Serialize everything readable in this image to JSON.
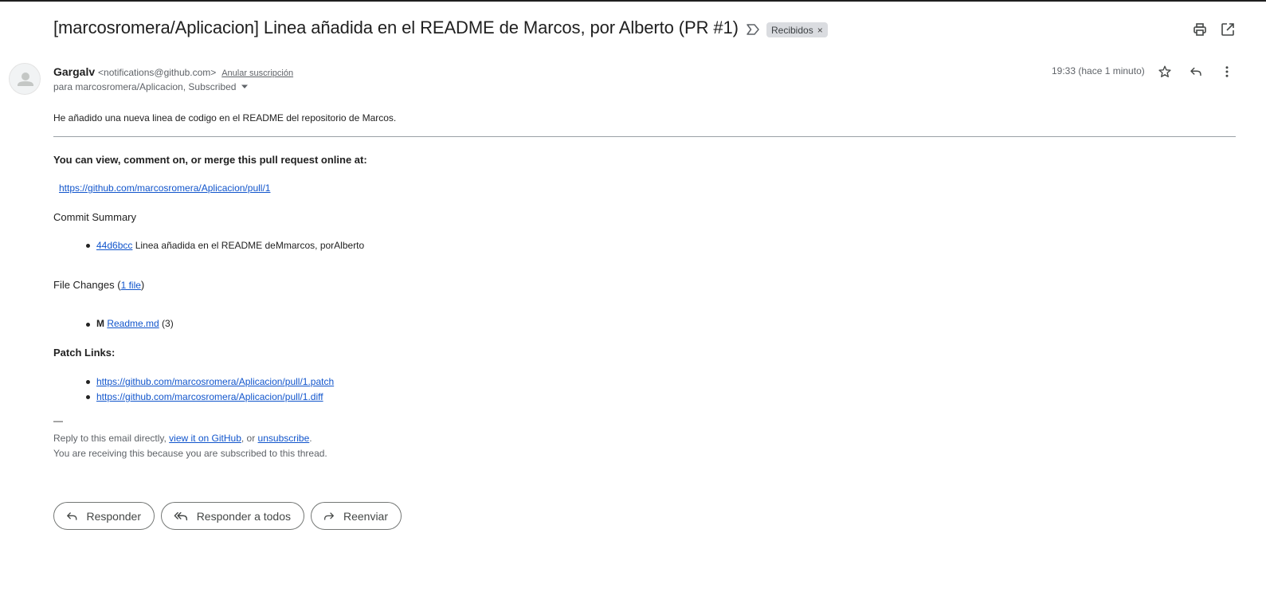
{
  "email": {
    "subject": "[marcosromera/Aplicacion] Linea añadida en el README de Marcos, por Alberto (PR #1)",
    "label": "Recibidos",
    "label_remove": "×",
    "sender": {
      "name": "Gargalv",
      "email": "<notifications@github.com>",
      "unsubscribe": "Anular suscripción"
    },
    "recipient": "para marcosromera/Aplicacion, Subscribed",
    "time": "19:33 (hace 1 minuto)",
    "icons": {
      "important": "label-important-icon",
      "print": "print-icon",
      "open_new": "open-in-new-window-icon",
      "star": "star-icon",
      "reply": "reply-icon",
      "more": "more-vert-icon",
      "avatar": "avatar-person-icon",
      "dropdown": "chevron-down-icon"
    }
  },
  "body": {
    "intro": "He añadido una nueva linea de codigo en el README del repositorio de Marcos.",
    "view_heading": "You can view, comment on, or merge this pull request online at:",
    "pr_link": "https://github.com/marcosromera/Aplicacion/pull/1",
    "commit_heading": "Commit Summary",
    "commit": {
      "hash": "44d6bcc",
      "message": " Linea añadida en el README deMmarcos, porAlberto"
    },
    "file_changes": {
      "heading": "File Changes",
      "open": " (",
      "count_link": "1 file",
      "close": ")",
      "file_mode": "M",
      "file_name": "Readme.md",
      "file_count": " (3)"
    },
    "patch_heading": "Patch Links:",
    "patch_links": [
      "https://github.com/marcosromera/Aplicacion/pull/1.patch",
      "https://github.com/marcosromera/Aplicacion/pull/1.diff"
    ]
  },
  "footer": {
    "dash": "—",
    "reply_prefix": "Reply to this email directly, ",
    "view_github": "view it on GitHub",
    "or": ", or ",
    "unsubscribe": "unsubscribe",
    "period": ".",
    "receiving": "You are receiving this because you are subscribed to this thread."
  },
  "actions": {
    "reply": "Responder",
    "reply_all": "Responder a todos",
    "forward": "Reenviar"
  },
  "colors": {
    "link": "#1155cc",
    "chip": "#dadce0",
    "muted": "#5f6368"
  }
}
